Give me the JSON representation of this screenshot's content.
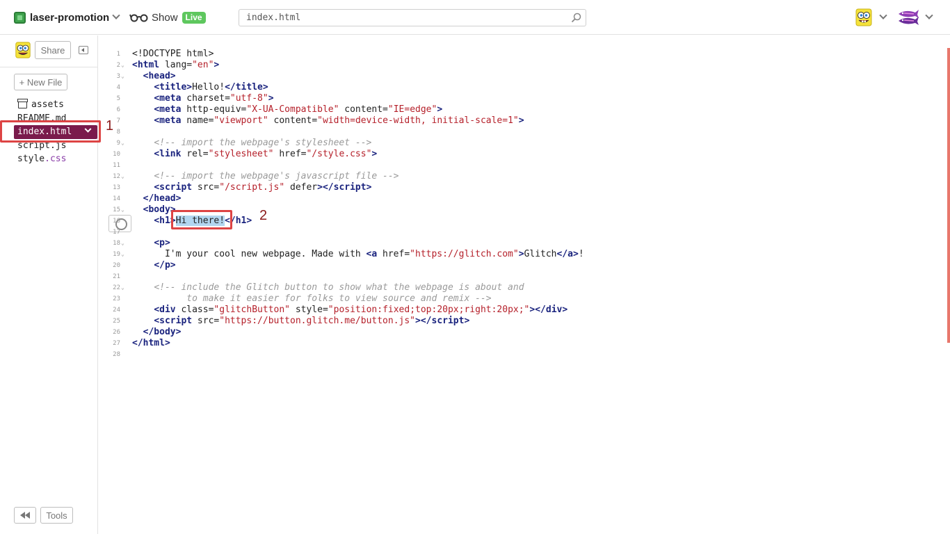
{
  "header": {
    "project_name": "laser-promotion",
    "show_label": "Show",
    "live_label": "Live",
    "search_placeholder": "index.html"
  },
  "sidebar": {
    "share_label": "Share",
    "new_file_label": "+ New File",
    "tools_label": "Tools",
    "files": [
      {
        "name": "assets",
        "ext": ""
      },
      {
        "name": "README.md",
        "ext": ""
      },
      {
        "name": "index.html",
        "ext": ""
      },
      {
        "name": "script.js",
        "ext": ""
      },
      {
        "name": "style",
        "ext": ".css"
      }
    ]
  },
  "editor": {
    "selected_text": "Hi there!",
    "lines": [
      {
        "n": "1",
        "fold": false
      },
      {
        "n": "2",
        "fold": true
      },
      {
        "n": "3",
        "fold": true
      },
      {
        "n": "4",
        "fold": false
      },
      {
        "n": "5",
        "fold": false
      },
      {
        "n": "6",
        "fold": false
      },
      {
        "n": "7",
        "fold": false
      },
      {
        "n": "8",
        "fold": false
      },
      {
        "n": "9",
        "fold": true
      },
      {
        "n": "10",
        "fold": false
      },
      {
        "n": "11",
        "fold": false
      },
      {
        "n": "12",
        "fold": true
      },
      {
        "n": "13",
        "fold": false
      },
      {
        "n": "14",
        "fold": false
      },
      {
        "n": "15",
        "fold": true
      },
      {
        "n": "16",
        "fold": false
      },
      {
        "n": "17",
        "fold": false
      },
      {
        "n": "18",
        "fold": true
      },
      {
        "n": "19",
        "fold": true
      },
      {
        "n": "20",
        "fold": false
      },
      {
        "n": "21",
        "fold": false
      },
      {
        "n": "22",
        "fold": true
      },
      {
        "n": "23",
        "fold": false
      },
      {
        "n": "24",
        "fold": false
      },
      {
        "n": "25",
        "fold": false
      },
      {
        "n": "26",
        "fold": false
      },
      {
        "n": "27",
        "fold": false
      },
      {
        "n": "28",
        "fold": false
      }
    ]
  },
  "annotations": {
    "label_1": "1",
    "label_2": "2"
  },
  "colors": {
    "active_file_bg": "#7a1b4c",
    "live_badge": "#5ec75e",
    "annotation_red": "#dd4444",
    "selection": "#b2d6f0"
  }
}
